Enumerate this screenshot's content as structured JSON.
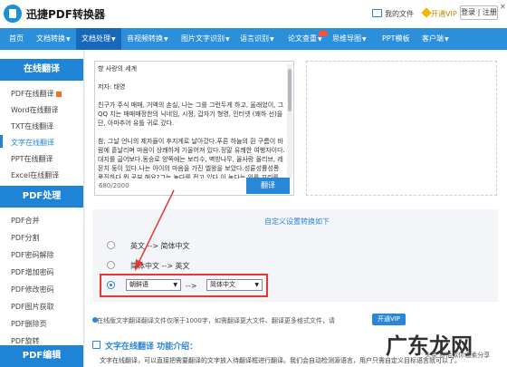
{
  "app": {
    "title": "迅捷PDF转换器"
  },
  "titlebar": {
    "my_files": "我的文件",
    "vip": "开通VIP",
    "login": "登录 | 注册",
    "controls": "□ ─ ✕"
  },
  "nav": {
    "items": [
      {
        "label": "首页"
      },
      {
        "label": "文档转换",
        "caret": "▼"
      },
      {
        "label": "文档处理",
        "caret": "▼"
      },
      {
        "label": "音视频转换",
        "caret": "▼"
      },
      {
        "label": "图片文字识别",
        "caret": "▼"
      },
      {
        "label": "语言识别",
        "caret": "▼"
      },
      {
        "label": "论文查重",
        "caret": "▼"
      },
      {
        "label": "思维导图",
        "caret": "▼"
      },
      {
        "label": "PPT模板"
      },
      {
        "label": "客户端",
        "caret": "▼"
      }
    ]
  },
  "sidebar": {
    "section1": "在线翻译",
    "items1": [
      "PDF在线翻译",
      "Word在线翻译",
      "TXT在线翻译",
      "文字在线翻译",
      "PPT在线翻译",
      "Excel在线翻译"
    ],
    "section2": "PDF处理",
    "items2": [
      "PDF合并",
      "PDF分割",
      "PDF密码解除",
      "PDF增加密码",
      "PDF修改密码",
      "PDF图片获取",
      "PDF删除页",
      "PDF旋转"
    ],
    "section3": "PDF编辑"
  },
  "editor": {
    "source_text": "향 사랑의 세계\n\n저자: 태영\n\n친구가 주식 매매, 거액의 손실, 나는 그를 그런두게 하고, 울래었이, 그 QQ 지는 매매매정한의 닉네임, 시정, 갑자기 형영, 인터넷 (꽤하 선)을 단, 아마추어 유틀 귀로 갔다.\n\n참, 그날 언니의 제자들이 후지게로 날아갔다.푸른 하늘의 흰 구름이 바람에 흩날리며 마음이 상쾌하게 기울어져 있다.정말 유쾌한 여행자이다.대지를 굽어보다.동승로 양쪽에는 보리수, 벽방나무, 올사랑 올리브, 레몬치 둥이 있다.나는 아이의 마음을 가진 엘왕을 보았다.성륜성륭성룡 풍진하다.뭐 공부 해요?그는 녹다를 접고 있다.이 녹다는 위를 꼬리를 가지고 깜딱하 어구 싫은 나쁘다고 표정을 하였다.",
    "char_count": "680/2000",
    "translate_btn": "翻译"
  },
  "options": {
    "title": "自定义设置转换如下",
    "opt1": "英文 --> 简体中文",
    "opt2": "简体中文 --> 英文",
    "from_lang": "朝鲜语",
    "arrow": "-->",
    "to_lang": "简体中文",
    "selected": 3
  },
  "info": {
    "text": "在线版文字翻译翻译文件仅限于1000字，如需翻译更大文件、翻译更多格式文件，请",
    "vip_btn": "开通VIP"
  },
  "intro": {
    "title": "文字在线翻译 功能介绍：",
    "desc": "文字在线翻译，可以直接把需要翻译的文字放入待翻译框进行翻译。我们会自动检测源语言，用户只需自定义目标语言就可以了。"
  },
  "watermark": {
    "big": "广东龙网",
    "sub": "头条 @恰似你温柔分享"
  },
  "colors": {
    "nav_bg": "#2c8fd9",
    "nav_active": "#1569b8",
    "accent": "#1f84d6",
    "highlight": "#e23a33"
  }
}
